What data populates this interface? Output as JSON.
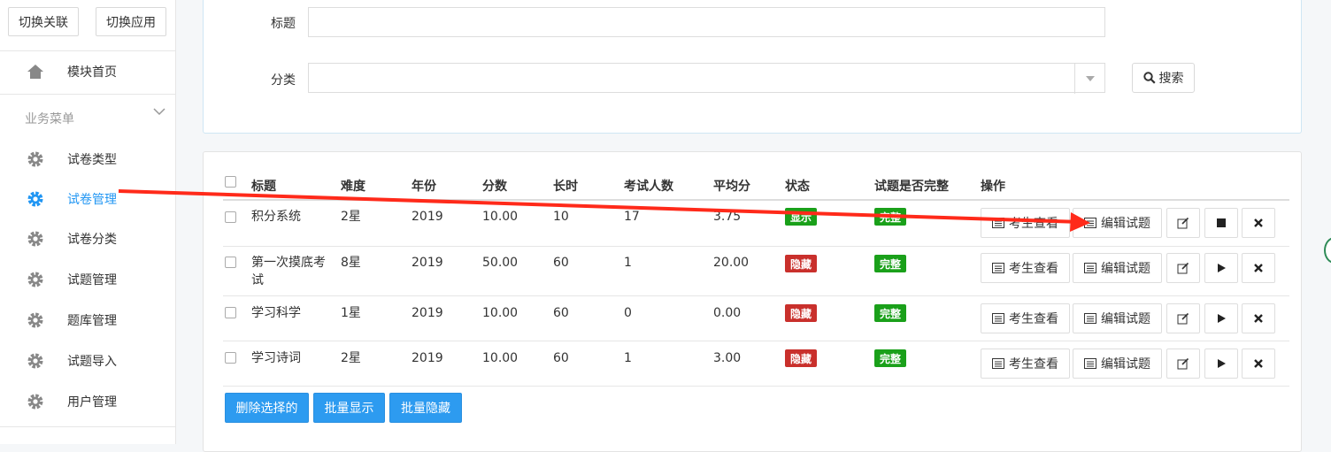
{
  "sidebar": {
    "switch_link": "切换关联",
    "switch_app": "切换应用",
    "home": "模块首页",
    "section": "业务菜单",
    "items": [
      {
        "label": "试卷类型"
      },
      {
        "label": "试卷管理"
      },
      {
        "label": "试卷分类"
      },
      {
        "label": "试题管理"
      },
      {
        "label": "题库管理"
      },
      {
        "label": "试题导入"
      },
      {
        "label": "用户管理"
      }
    ]
  },
  "search": {
    "title_label": "标题",
    "title_value": "",
    "category_label": "分类",
    "category_value": "",
    "search_button": "搜索"
  },
  "table": {
    "headers": [
      "标题",
      "难度",
      "年份",
      "分数",
      "长时",
      "考试人数",
      "平均分",
      "状态",
      "试题是否完整",
      "操作"
    ],
    "rows": [
      {
        "title": "积分系统",
        "difficulty": "2星",
        "year": "2019",
        "score": "10.00",
        "duration": "10",
        "takers": "17",
        "avg": "3.75",
        "status": "显示",
        "complete": "完整"
      },
      {
        "title": "第一次摸底考试",
        "difficulty": "8星",
        "year": "2019",
        "score": "50.00",
        "duration": "60",
        "takers": "1",
        "avg": "20.00",
        "status": "隐藏",
        "complete": "完整"
      },
      {
        "title": "学习科学",
        "difficulty": "1星",
        "year": "2019",
        "score": "10.00",
        "duration": "60",
        "takers": "0",
        "avg": "0.00",
        "status": "隐藏",
        "complete": "完整"
      },
      {
        "title": "学习诗词",
        "difficulty": "2星",
        "year": "2019",
        "score": "10.00",
        "duration": "60",
        "takers": "1",
        "avg": "3.00",
        "status": "隐藏",
        "complete": "完整"
      }
    ],
    "op_view": "考生查看",
    "op_edit_questions": "编辑试题"
  },
  "bulk": {
    "delete": "删除选择的",
    "show": "批量显示",
    "hide": "批量隐藏"
  },
  "colors": {
    "accent": "#2196f3",
    "annotation": "#ff2a1a",
    "badge_red": "#c9302c",
    "badge_green": "#1aa01a"
  }
}
